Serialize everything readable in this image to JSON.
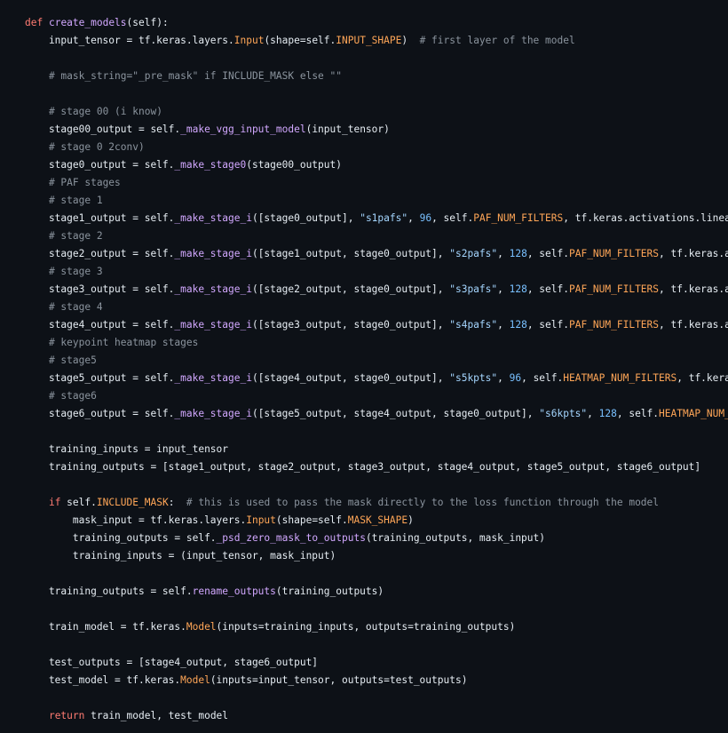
{
  "palette": {
    "background": "#0d1117",
    "plain": "#e6edf3",
    "keyword": "#ff7b72",
    "function": "#d2a8ff",
    "comment": "#8b949e",
    "string": "#a5d6ff",
    "number": "#79c0ff",
    "constant": "#ffa657"
  },
  "code": {
    "language": "python",
    "lines": [
      [
        [
          "k",
          "def"
        ],
        [
          "p",
          " "
        ],
        [
          "f",
          "create_models"
        ],
        [
          "p",
          "(self):"
        ]
      ],
      [
        [
          "p",
          "    input_tensor = tf.keras.layers."
        ],
        [
          "a",
          "Input"
        ],
        [
          "p",
          "(shape=self."
        ],
        [
          "a",
          "INPUT_SHAPE"
        ],
        [
          "p",
          ")  "
        ],
        [
          "c",
          "# first layer of the model"
        ]
      ],
      [],
      [
        [
          "p",
          "    "
        ],
        [
          "c",
          "# mask_string=\"_pre_mask\" if INCLUDE_MASK else \"\""
        ]
      ],
      [],
      [
        [
          "p",
          "    "
        ],
        [
          "c",
          "# stage 00 (i know)"
        ]
      ],
      [
        [
          "p",
          "    stage00_output = self."
        ],
        [
          "f",
          "_make_vgg_input_model"
        ],
        [
          "p",
          "(input_tensor)"
        ]
      ],
      [
        [
          "p",
          "    "
        ],
        [
          "c",
          "# stage 0 2conv)"
        ]
      ],
      [
        [
          "p",
          "    stage0_output = self."
        ],
        [
          "f",
          "_make_stage0"
        ],
        [
          "p",
          "(stage00_output)"
        ]
      ],
      [
        [
          "p",
          "    "
        ],
        [
          "c",
          "# PAF stages"
        ]
      ],
      [
        [
          "p",
          "    "
        ],
        [
          "c",
          "# stage 1"
        ]
      ],
      [
        [
          "p",
          "    stage1_output = self."
        ],
        [
          "f",
          "_make_stage_i"
        ],
        [
          "p",
          "([stage0_output], "
        ],
        [
          "s",
          "\"s1pafs\""
        ],
        [
          "p",
          ", "
        ],
        [
          "n",
          "96"
        ],
        [
          "p",
          ", self."
        ],
        [
          "a",
          "PAF_NUM_FILTERS"
        ],
        [
          "p",
          ", tf.keras.activations.linear)"
        ]
      ],
      [
        [
          "p",
          "    "
        ],
        [
          "c",
          "# stage 2"
        ]
      ],
      [
        [
          "p",
          "    stage2_output = self."
        ],
        [
          "f",
          "_make_stage_i"
        ],
        [
          "p",
          "([stage1_output, stage0_output], "
        ],
        [
          "s",
          "\"s2pafs\""
        ],
        [
          "p",
          ", "
        ],
        [
          "n",
          "128"
        ],
        [
          "p",
          ", self."
        ],
        [
          "a",
          "PAF_NUM_FILTERS"
        ],
        [
          "p",
          ", tf.keras.act"
        ]
      ],
      [
        [
          "p",
          "    "
        ],
        [
          "c",
          "# stage 3"
        ]
      ],
      [
        [
          "p",
          "    stage3_output = self."
        ],
        [
          "f",
          "_make_stage_i"
        ],
        [
          "p",
          "([stage2_output, stage0_output], "
        ],
        [
          "s",
          "\"s3pafs\""
        ],
        [
          "p",
          ", "
        ],
        [
          "n",
          "128"
        ],
        [
          "p",
          ", self."
        ],
        [
          "a",
          "PAF_NUM_FILTERS"
        ],
        [
          "p",
          ", tf.keras.act"
        ]
      ],
      [
        [
          "p",
          "    "
        ],
        [
          "c",
          "# stage 4"
        ]
      ],
      [
        [
          "p",
          "    stage4_output = self."
        ],
        [
          "f",
          "_make_stage_i"
        ],
        [
          "p",
          "([stage3_output, stage0_output], "
        ],
        [
          "s",
          "\"s4pafs\""
        ],
        [
          "p",
          ", "
        ],
        [
          "n",
          "128"
        ],
        [
          "p",
          ", self."
        ],
        [
          "a",
          "PAF_NUM_FILTERS"
        ],
        [
          "p",
          ", tf.keras.act"
        ]
      ],
      [
        [
          "p",
          "    "
        ],
        [
          "c",
          "# keypoint heatmap stages"
        ]
      ],
      [
        [
          "p",
          "    "
        ],
        [
          "c",
          "# stage5"
        ]
      ],
      [
        [
          "p",
          "    stage5_output = self."
        ],
        [
          "f",
          "_make_stage_i"
        ],
        [
          "p",
          "([stage4_output, stage0_output], "
        ],
        [
          "s",
          "\"s5kpts\""
        ],
        [
          "p",
          ", "
        ],
        [
          "n",
          "96"
        ],
        [
          "p",
          ", self."
        ],
        [
          "a",
          "HEATMAP_NUM_FILTERS"
        ],
        [
          "p",
          ", tf.keras."
        ]
      ],
      [
        [
          "p",
          "    "
        ],
        [
          "c",
          "# stage6"
        ]
      ],
      [
        [
          "p",
          "    stage6_output = self."
        ],
        [
          "f",
          "_make_stage_i"
        ],
        [
          "p",
          "([stage5_output, stage4_output, stage0_output], "
        ],
        [
          "s",
          "\"s6kpts\""
        ],
        [
          "p",
          ", "
        ],
        [
          "n",
          "128"
        ],
        [
          "p",
          ", self."
        ],
        [
          "a",
          "HEATMAP_NUM_FI"
        ]
      ],
      [],
      [
        [
          "p",
          "    training_inputs = input_tensor"
        ]
      ],
      [
        [
          "p",
          "    training_outputs = [stage1_output, stage2_output, stage3_output, stage4_output, stage5_output, stage6_output]"
        ]
      ],
      [],
      [
        [
          "p",
          "    "
        ],
        [
          "k",
          "if"
        ],
        [
          "p",
          " self."
        ],
        [
          "a",
          "INCLUDE_MASK"
        ],
        [
          "p",
          ":  "
        ],
        [
          "c",
          "# this is used to pass the mask directly to the loss function through the model"
        ]
      ],
      [
        [
          "p",
          "        mask_input = tf.keras.layers."
        ],
        [
          "a",
          "Input"
        ],
        [
          "p",
          "(shape=self."
        ],
        [
          "a",
          "MASK_SHAPE"
        ],
        [
          "p",
          ")"
        ]
      ],
      [
        [
          "p",
          "        training_outputs = self."
        ],
        [
          "f",
          "_psd_zero_mask_to_outputs"
        ],
        [
          "p",
          "(training_outputs, mask_input)"
        ]
      ],
      [
        [
          "p",
          "        training_inputs = (input_tensor, mask_input)"
        ]
      ],
      [],
      [
        [
          "p",
          "    training_outputs = self."
        ],
        [
          "f",
          "rename_outputs"
        ],
        [
          "p",
          "(training_outputs)"
        ]
      ],
      [],
      [
        [
          "p",
          "    train_model = tf.keras."
        ],
        [
          "a",
          "Model"
        ],
        [
          "p",
          "(inputs=training_inputs, outputs=training_outputs)"
        ]
      ],
      [],
      [
        [
          "p",
          "    test_outputs = [stage4_output, stage6_output]"
        ]
      ],
      [
        [
          "p",
          "    test_model = tf.keras."
        ],
        [
          "a",
          "Model"
        ],
        [
          "p",
          "(inputs=input_tensor, outputs=test_outputs)"
        ]
      ],
      [],
      [
        [
          "p",
          "    "
        ],
        [
          "k",
          "return"
        ],
        [
          "p",
          " train_model, test_model"
        ]
      ]
    ]
  }
}
